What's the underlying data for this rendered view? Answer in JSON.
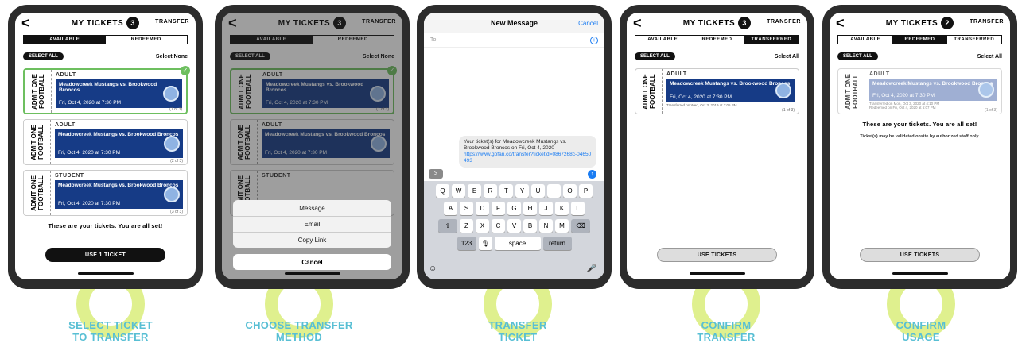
{
  "app": {
    "title": "MY TICKETS",
    "transfer_label": "TRANSFER",
    "tab_available": "AVAILABLE",
    "tab_redeemed": "REDEEMED",
    "tab_transferred": "TRANSFERRED",
    "select_all": "SELECT ALL",
    "select_none": "Select None",
    "select_all_link": "Select All",
    "stub_text": "ADMIT ONE\nFOOTBALL",
    "game_name": "Meadowcreek Mustangs vs. Brookwood Broncos",
    "game_date": "Fri, Oct 4, 2020 at 7:30 PM",
    "all_set": "These are your tickets. You are all set!",
    "use_one": "USE 1 TICKET",
    "use_tickets": "USE TICKETS",
    "validation_note": "Ticket(s) may be validated onsite by authorized staff only."
  },
  "screen1": {
    "count": "3",
    "tickets": [
      {
        "type": "ADULT",
        "num": "(1 of 3)"
      },
      {
        "type": "ADULT",
        "num": "(2 of 3)"
      },
      {
        "type": "STUDENT",
        "num": "(3 of 3)"
      }
    ]
  },
  "screen2": {
    "count": "3",
    "sheet": [
      "Message",
      "Email",
      "Copy Link"
    ],
    "cancel": "Cancel"
  },
  "screen3": {
    "title": "New Message",
    "cancel": "Cancel",
    "to": "To:",
    "bubble_text": "Your ticket(s) for Meadowcreek Mustangs vs. Brookwood Broncos on Fri, Oct 4, 2020",
    "bubble_link": "https://www.gofan.co/transfer?ticketid=0867268c-04650493",
    "keys_row1": [
      "Q",
      "W",
      "E",
      "R",
      "T",
      "Y",
      "U",
      "I",
      "O",
      "P"
    ],
    "keys_row2": [
      "A",
      "S",
      "D",
      "F",
      "G",
      "H",
      "J",
      "K",
      "L"
    ],
    "keys_row3": [
      "Z",
      "X",
      "C",
      "V",
      "B",
      "N",
      "M"
    ],
    "key_123": "123",
    "key_space": "space",
    "key_return": "return"
  },
  "screen4": {
    "count": "3",
    "ticket_type": "ADULT",
    "ticket_num": "(1 of 3)",
    "ticket_note": "Transferred on Wed, Oct 3, 2019 at 3:05 PM"
  },
  "screen5": {
    "count": "2",
    "ticket_type": "ADULT",
    "ticket_num": "(1 of 3)",
    "ticket_note1": "Transferred on Mon, Oct 3, 2020 at 4:10 PM",
    "ticket_note2": "Redeemed on Fri, Oct 4, 2020 at 6:07 PM"
  },
  "steps": [
    {
      "line1": "SELECT TICKET",
      "line2": "TO TRANSFER"
    },
    {
      "line1": "CHOOSE TRANSFER",
      "line2": "METHOD"
    },
    {
      "line1": "TRANSFER",
      "line2": "TICKET"
    },
    {
      "line1": "CONFIRM",
      "line2": "TRANSFER"
    },
    {
      "line1": "CONFIRM",
      "line2": "USAGE"
    }
  ],
  "colors": {
    "accent_ring": "#dff08e",
    "step_text": "#58bfd4",
    "ticket_blue": "#163b86",
    "selected_green": "#6dbf5f"
  }
}
